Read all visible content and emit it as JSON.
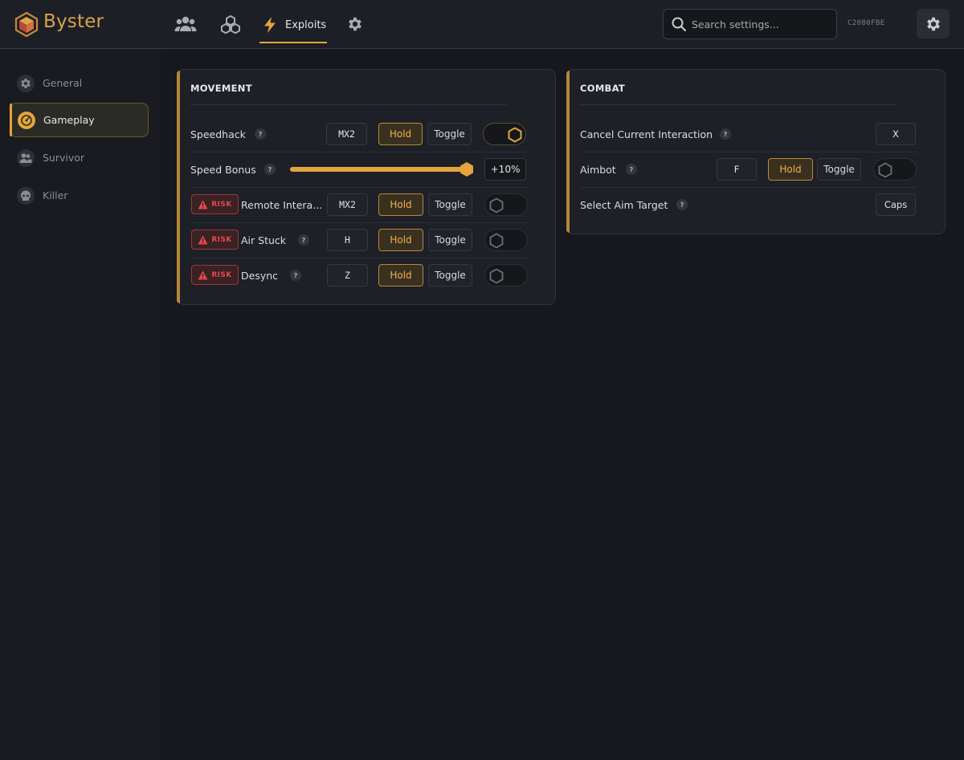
{
  "app": {
    "brand": "Byster",
    "hwid": "C2080FBE",
    "search_placeholder": "Search settings...",
    "active_tab": "Exploits",
    "accent": "#e3a53c",
    "risk_color": "#e24a4a"
  },
  "nav": {
    "icons": [
      "users-icon",
      "cubes-icon",
      "lightning-icon",
      "gear-icon"
    ],
    "active_tab_label": "Exploits"
  },
  "sidebar": {
    "items": [
      {
        "label": "General",
        "icon": "gear-icon"
      },
      {
        "label": "Gameplay",
        "icon": "gauge-icon",
        "active": true
      },
      {
        "label": "Survivor",
        "icon": "users-icon"
      },
      {
        "label": "Killer",
        "icon": "skull-icon"
      }
    ]
  },
  "movement": {
    "title": "MOVEMENT",
    "speedhack": {
      "label": "Speedhack",
      "help": "?",
      "key": "MX2",
      "hold": "Hold",
      "toggle": "Toggle",
      "enabled": true
    },
    "speed_bonus": {
      "label": "Speed Bonus",
      "help": "?",
      "value": "+10%",
      "level": 1.0
    },
    "remote": {
      "risk": "RISK",
      "label": "Remote Intera...",
      "key": "MX2",
      "hold": "Hold",
      "toggle": "Toggle",
      "enabled": false
    },
    "air_stuck": {
      "risk": "RISK",
      "label": "Air Stuck",
      "help": "?",
      "key": "H",
      "hold": "Hold",
      "toggle": "Toggle",
      "enabled": false
    },
    "desync": {
      "risk": "RISK",
      "label": "Desync",
      "help": "?",
      "key": "Z",
      "hold": "Hold",
      "toggle": "Toggle",
      "enabled": false
    }
  },
  "combat": {
    "title": "COMBAT",
    "cancel": {
      "label": "Cancel Current Interaction",
      "help": "?",
      "key": "X"
    },
    "aimbot": {
      "label": "Aimbot",
      "help": "?",
      "key": "F",
      "hold": "Hold",
      "toggle": "Toggle",
      "enabled": false
    },
    "aim_target": {
      "label": "Select Aim Target",
      "help": "?",
      "key": "Caps"
    }
  }
}
